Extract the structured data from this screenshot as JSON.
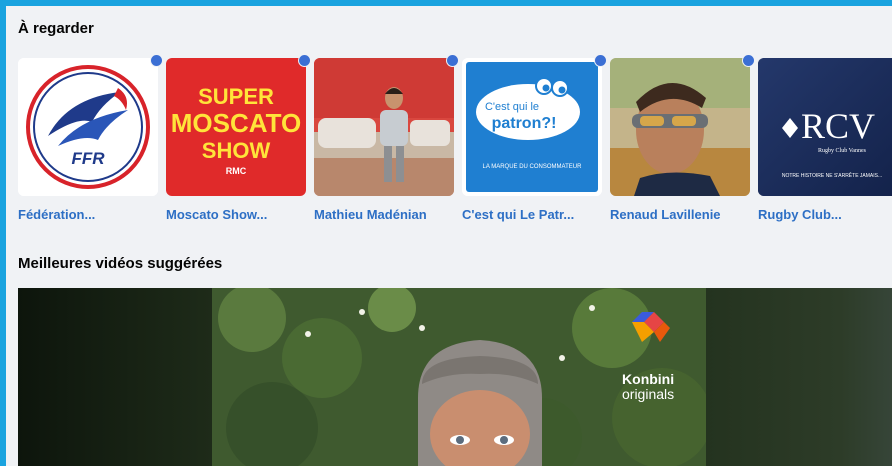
{
  "watch": {
    "title": "À regarder",
    "pages": [
      {
        "name": "Fédération...",
        "logo_text": "FFR"
      },
      {
        "name": "Moscato Show...",
        "logo_lines": [
          "SUPER",
          "MOSCATO",
          "SHOW"
        ],
        "logo_sub": "RMC"
      },
      {
        "name": "Mathieu Madénian"
      },
      {
        "name": "C'est qui Le Patr...",
        "logo_lines": [
          "C'est qui le",
          "patron?!"
        ],
        "logo_sub": "LA MARQUE DU CONSOMMATEUR"
      },
      {
        "name": "Renaud Lavillenie"
      },
      {
        "name": "Rugby Club...",
        "logo_text": "RCV",
        "logo_sub": "Rugby Club Vannes",
        "logo_tagline": "NOTRE HISTOIRE NE S'ARRÊTE JAMAIS..."
      }
    ]
  },
  "suggestions": {
    "title": "Meilleures vidéos suggérées",
    "video": {
      "brand_line1": "Konbini",
      "brand_line2": "originals"
    }
  },
  "colors": {
    "frame": "#1aa3df",
    "background": "#f0f2f5",
    "link": "#2d6fc5",
    "live_dot": "#3b6fd4"
  }
}
